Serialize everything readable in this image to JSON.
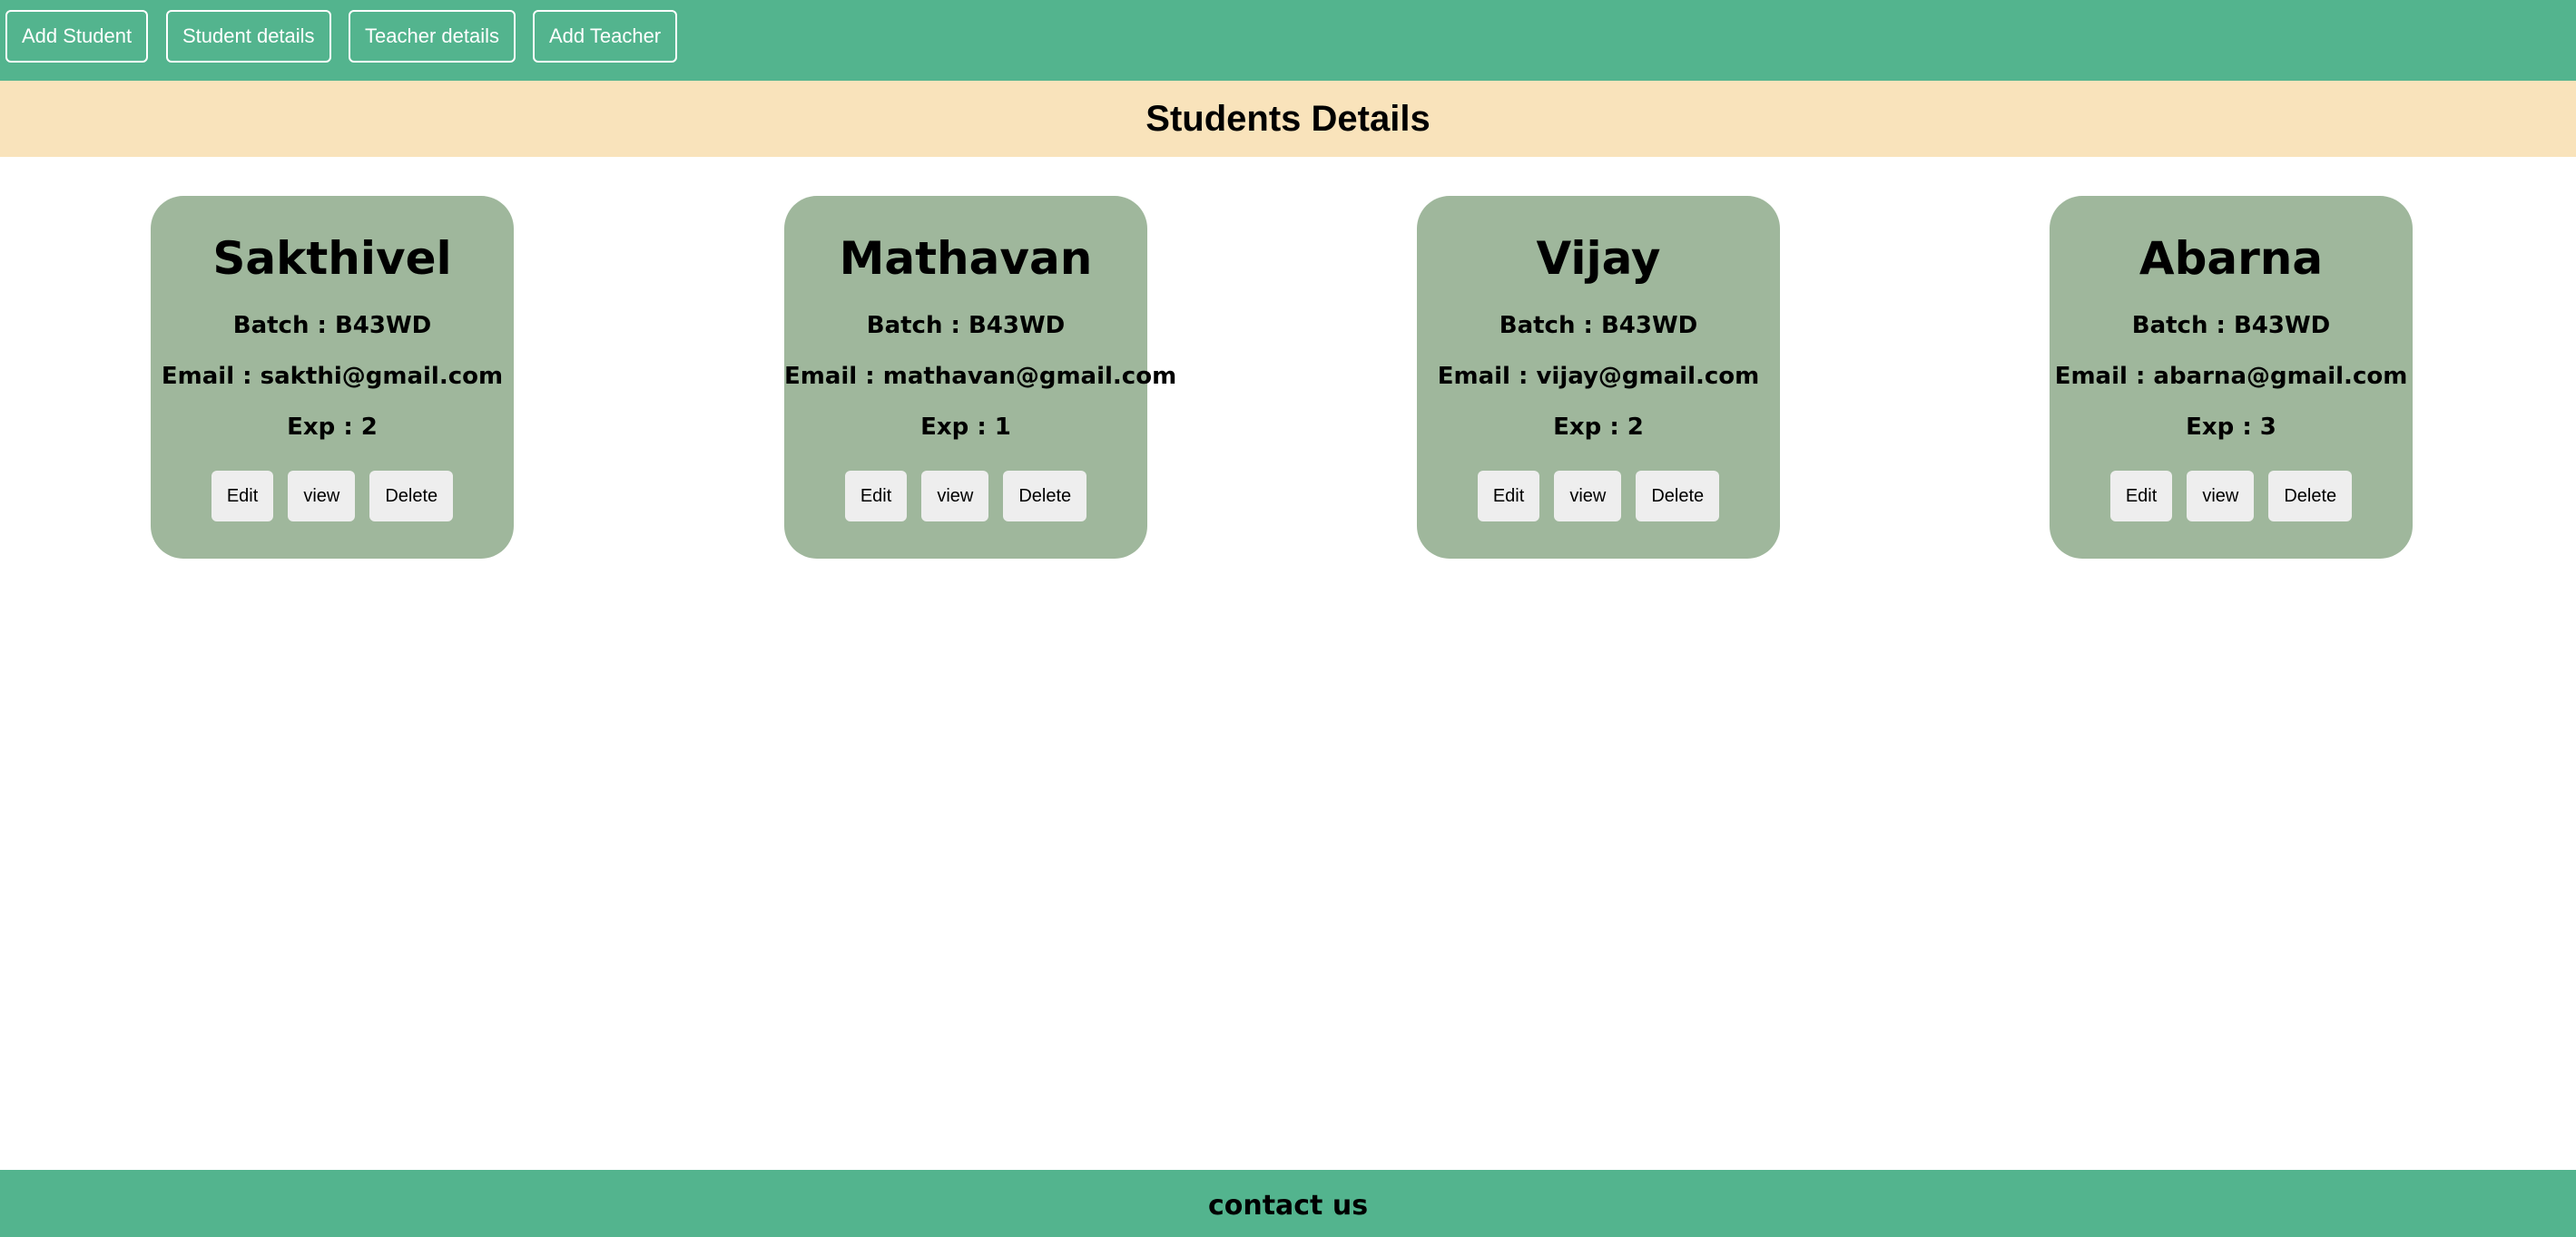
{
  "nav": {
    "add_student": "Add Student",
    "student_details": "Student details",
    "teacher_details": "Teacher details",
    "add_teacher": "Add Teacher"
  },
  "banner": {
    "title": "Students Details"
  },
  "students": [
    {
      "name": "Sakthivel",
      "batch": "Batch : B43WD",
      "email": "Email : sakthi@gmail.com",
      "exp": "Exp : 2"
    },
    {
      "name": "Mathavan",
      "batch": "Batch : B43WD",
      "email": "Email : mathavan@gmail.com",
      "exp": "Exp : 1"
    },
    {
      "name": "Vijay",
      "batch": "Batch : B43WD",
      "email": "Email : vijay@gmail.com",
      "exp": "Exp : 2"
    },
    {
      "name": "Abarna",
      "batch": "Batch : B43WD",
      "email": "Email : abarna@gmail.com",
      "exp": "Exp : 3"
    }
  ],
  "card_actions": {
    "edit": "Edit",
    "view": "view",
    "delete": "Delete"
  },
  "footer": {
    "title": "contact us"
  },
  "colors": {
    "navbar": "#53b48e",
    "banner": "#f9e3bb",
    "card": "#9fb79c",
    "action_button": "#eeeeee"
  }
}
